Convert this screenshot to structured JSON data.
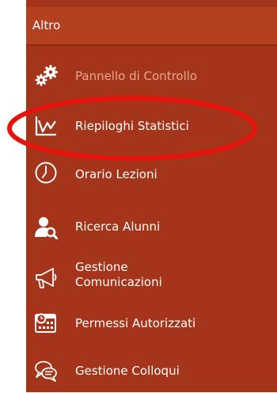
{
  "menu": {
    "header": "Altro",
    "items": [
      {
        "label": "Pannello di Controllo",
        "icon": "gears-icon",
        "dim": true
      },
      {
        "label": "Riepiloghi Statistici",
        "icon": "chart-icon"
      },
      {
        "label": "Orario Lezioni",
        "icon": "clock-icon"
      },
      {
        "label": "Ricerca Alunni",
        "icon": "user-search-icon"
      },
      {
        "label_line1": "Gestione",
        "label_line2": "Comunicazioni",
        "icon": "megaphone-icon"
      },
      {
        "label": "Permessi Autorizzati",
        "icon": "calendar-clock-icon"
      },
      {
        "label": "Gestione Colloqui",
        "icon": "chat-bubbles-icon"
      }
    ]
  },
  "colors": {
    "menu_bg": "#a4351b",
    "header_bg": "#b3411f",
    "highlight_ring": "#e8120c"
  }
}
